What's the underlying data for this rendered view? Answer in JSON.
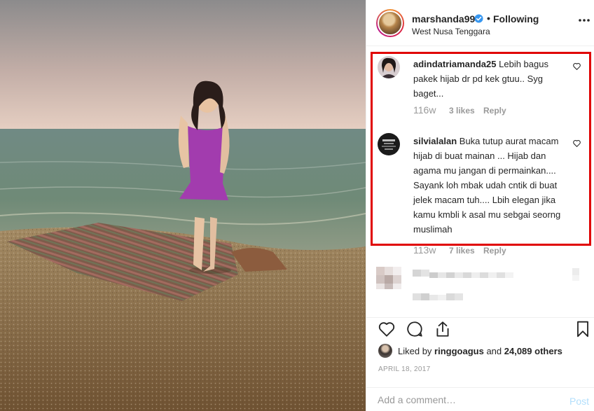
{
  "header": {
    "username": "marshanda99",
    "separator": "•",
    "following_label": "Following",
    "location": "West Nusa Tenggara"
  },
  "comments": [
    {
      "username": "adindatriamanda25",
      "text": "Lebih bagus pakek hijab dr pd kek gtuu.. Syg baget...",
      "age": "116w",
      "likes": "3 likes",
      "reply_label": "Reply"
    },
    {
      "username": "silvialalan",
      "text": "Buka tutup aurat macam hijab di buat mainan ... Hijab dan agama mu jangan di permainkan.... Sayank loh mbak udah cntik di buat jelek macam tuh.... Lbih elegan jika kamu kmbli k asal mu sebgai seorng muslimah",
      "age": "113w",
      "likes": "7 likes",
      "reply_label": "Reply"
    }
  ],
  "likes_summary": {
    "prefix": "Liked by ",
    "user": "ringgoagus",
    "middle": " and ",
    "count": "24,089 others"
  },
  "post_date": "APRIL 18, 2017",
  "add_comment": {
    "placeholder": "Add a comment…",
    "post_label": "Post"
  },
  "colors": {
    "highlight_border": "#e00000",
    "verified_badge": "#3897f0",
    "post_button_disabled": "#b2dffc",
    "muted_text": "#999999"
  },
  "icons": {
    "verified": "verified-badge-icon",
    "more": "more-options-icon",
    "comment_like": "heart-outline-icon",
    "like": "heart-outline-icon",
    "comment": "speech-bubble-icon",
    "share": "share-arrow-icon",
    "save": "bookmark-icon"
  }
}
